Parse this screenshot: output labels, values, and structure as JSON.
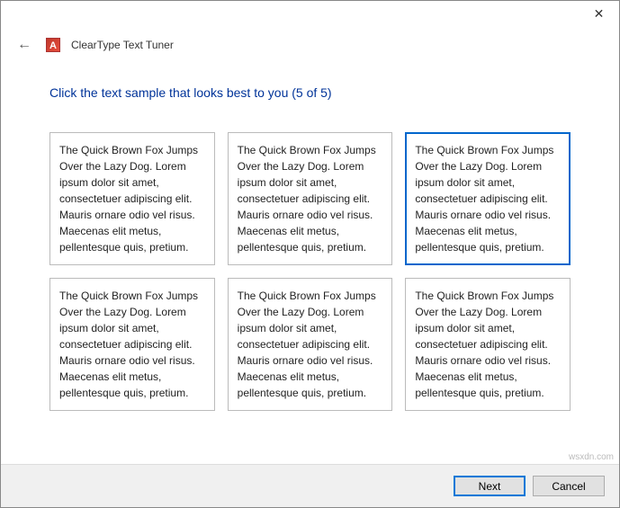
{
  "window": {
    "app_title": "ClearType Text Tuner",
    "close_label": "✕"
  },
  "instruction": "Click the text sample that looks best to you (5 of 5)",
  "sample_text": "The Quick Brown Fox Jumps Over the Lazy Dog. Lorem ipsum dolor sit amet, consectetuer adipiscing elit. Mauris ornare odio vel risus. Maecenas elit metus, pellentesque quis, pretium.",
  "samples": {
    "count": 6,
    "selected_index": 2
  },
  "buttons": {
    "next": "Next",
    "cancel": "Cancel"
  },
  "watermark": "wsxdn.com",
  "colors": {
    "instruction": "#003399",
    "selection_border": "#0066cc"
  }
}
